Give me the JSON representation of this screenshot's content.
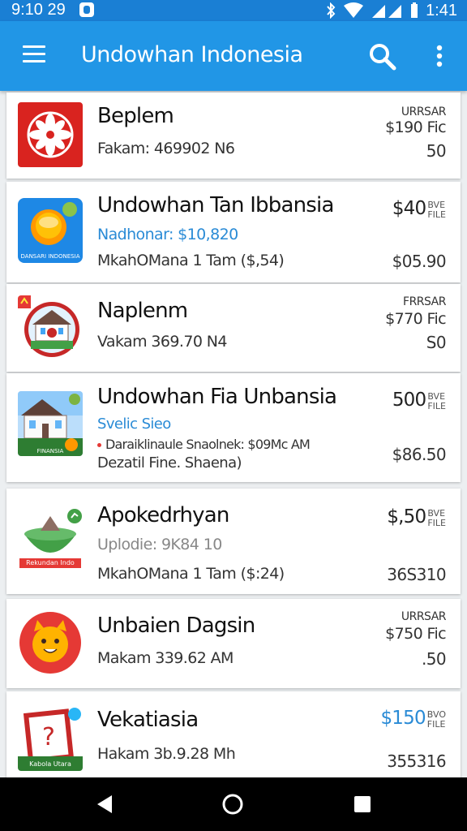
{
  "status_bar": {
    "left_time": "9:10 29",
    "clock": "1:41",
    "icons": [
      "notification-icon",
      "bluetooth-icon",
      "wifi-icon",
      "signal-icon",
      "battery-icon"
    ]
  },
  "app_bar": {
    "title": "Undowhan Indonesia",
    "menu_icon": "hamburger-menu-icon",
    "search_icon": "search-icon",
    "more_icon": "more-vert-icon",
    "color": "#2196e6"
  },
  "items": [
    {
      "name": "Beplem",
      "line1": "Fakam: 469902 N6",
      "r_top": "URRSAR",
      "r_mid": "$190 Fic",
      "r_bottom": "50"
    },
    {
      "name": "Undowhan Tan Ibbansia",
      "line1": "Nadhonar: $10,820",
      "line2": "MkahOMana 1 Tam ($,54)",
      "price": "$40",
      "price_tag_1": "BVE",
      "price_tag_2": "FILE",
      "r_bottom": "$05.90"
    },
    {
      "name": "Naplenm",
      "line1": "Vakam 369.70 N4",
      "r_top": "FRRSAR",
      "r_mid": "$770 Fic",
      "r_bottom": "S0"
    },
    {
      "name": "Undowhan Fia Unbansia",
      "line1": "Svelic Sieo",
      "line2": "Daraiklinaule Snaolnek: $09Mc AM",
      "line3": "Dezatil Fine. Shaena)",
      "price": "500",
      "price_tag_1": "BVE",
      "price_tag_2": "FILE",
      "r_bottom": "$86.50"
    },
    {
      "name": "Apokedrhyan",
      "line1": "Uplodie: 9K84 10",
      "line2": "MkahOMana 1 Tam ($:24)",
      "price": "$,50",
      "price_tag_1": "BVE",
      "price_tag_2": "FILE",
      "r_bottom": "36S310"
    },
    {
      "name": "Unbaien Dagsin",
      "line1": "Makam 339.62 AM",
      "r_top": "URRSAR",
      "r_mid": "$750 Fic",
      "r_bottom": ".50"
    },
    {
      "name": "Vekatiasia",
      "line1": "Hakam 3b.9.28 Mh",
      "price": "$150",
      "price_tag_1": "BVO",
      "price_tag_2": "FILE",
      "r_bottom": "355316"
    }
  ],
  "thumbs": {
    "t2_caption": "DANSARI INDONESIA",
    "t4_caption": "FINANSIA",
    "t5_caption": "Rekundan Indo",
    "t7_caption": "Kabola Utara"
  },
  "nav": {
    "back_icon": "back-triangle-icon",
    "home_icon": "home-circle-icon",
    "recents_icon": "recents-square-icon"
  }
}
